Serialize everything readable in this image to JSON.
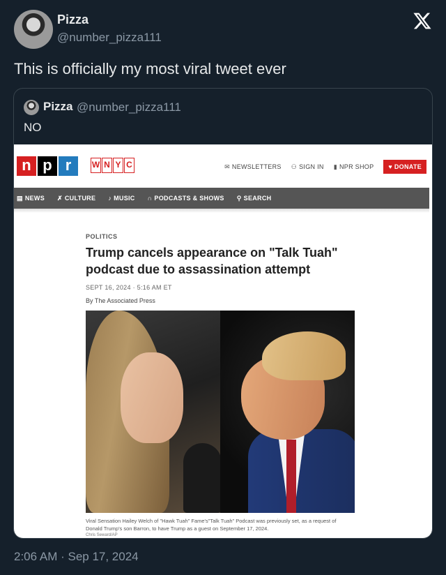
{
  "author": {
    "name": "Pizza",
    "handle": "@number_pizza111"
  },
  "tweet": {
    "text": "This is officially my most viral tweet ever",
    "timestamp": "2:06 AM · Sep 17, 2024"
  },
  "quoted": {
    "name": "Pizza",
    "handle": "@number_pizza111",
    "text": "NO",
    "screenshot": {
      "logo_npr": [
        "n",
        "p",
        "r"
      ],
      "logo_wnyc": [
        "W",
        "N",
        "Y",
        "C"
      ],
      "top_links": {
        "newsletters": "NEWSLETTERS",
        "sign_in": "SIGN IN",
        "shop": "NPR SHOP",
        "donate": "DONATE"
      },
      "nav": {
        "news": "NEWS",
        "culture": "CULTURE",
        "music": "MUSIC",
        "podcasts": "PODCASTS & SHOWS",
        "search": "SEARCH"
      },
      "article": {
        "section": "POLITICS",
        "headline": "Trump cancels appearance on \"Talk Tuah\" podcast due to assassination attempt",
        "date": "SEPT 16, 2024 · 5:16 AM ET",
        "byline": "By The Associated Press",
        "caption": "Viral Sensation Hailey Welch of \"Hawk Tuah\" Fame's\"Talk Tuah\" Podcast was previously set, as a request of Donald Trump's son Barron, to have Trump as a guest on September 17, 2024.",
        "credit": "Chris Seward/AP"
      }
    }
  },
  "colors": {
    "background": "#15202b",
    "npr_red": "#d62021",
    "npr_blue": "#237bbd",
    "nav_gray": "#555555"
  },
  "icons": {
    "brand": "x-logo-icon",
    "newsletters": "envelope-icon",
    "sign_in": "user-icon",
    "shop": "bag-icon"
  }
}
